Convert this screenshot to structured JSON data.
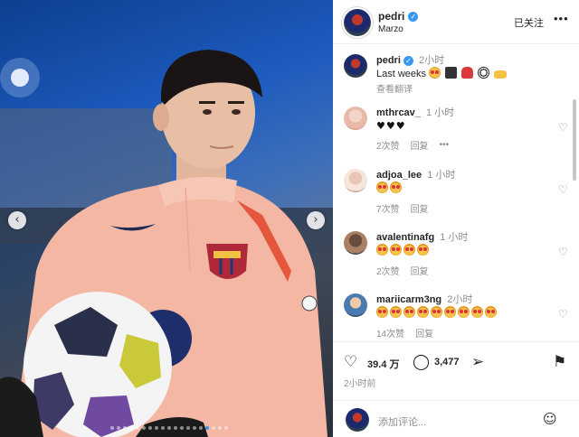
{
  "post": {
    "username": "pedri",
    "location": "Marzo",
    "follow_label": "已关注",
    "more_label": "•••",
    "nav_prev": "‹",
    "nav_next": "›"
  },
  "caption": {
    "username": "pedri",
    "time": "2小时",
    "text": "Last weeks",
    "emoji_names": [
      "sleepy-face-icon",
      "camera-icon",
      "shoe-icon",
      "soccer-ball-icon",
      "hand-icon"
    ],
    "translate_label": "查看翻译"
  },
  "comments": [
    {
      "username": "mthrcav_",
      "time": "1 小时",
      "text": "♥♥♥",
      "likes": "2次赞",
      "reply": "回复",
      "more": "•••"
    },
    {
      "username": "adjoa_lee",
      "time": "1 小时",
      "emoji_count": 2,
      "likes": "7次赞",
      "reply": "回复"
    },
    {
      "username": "avalentinafg",
      "time": "1 小时",
      "emoji_count": 4,
      "likes": "2次赞",
      "reply": "回复"
    },
    {
      "username": "mariicarm3ng",
      "time": "2小时",
      "emoji_count": 9,
      "likes": "14次赞",
      "reply": "回复"
    }
  ],
  "actions": {
    "likes": "39.4 万",
    "comments": "3,477",
    "posted": "2小时前"
  },
  "add_comment": {
    "placeholder": "添加评论..."
  },
  "colors": {
    "accent": "#3897f0",
    "jersey": "#f4b7a4",
    "secondary_text": "#8e8e8e"
  }
}
